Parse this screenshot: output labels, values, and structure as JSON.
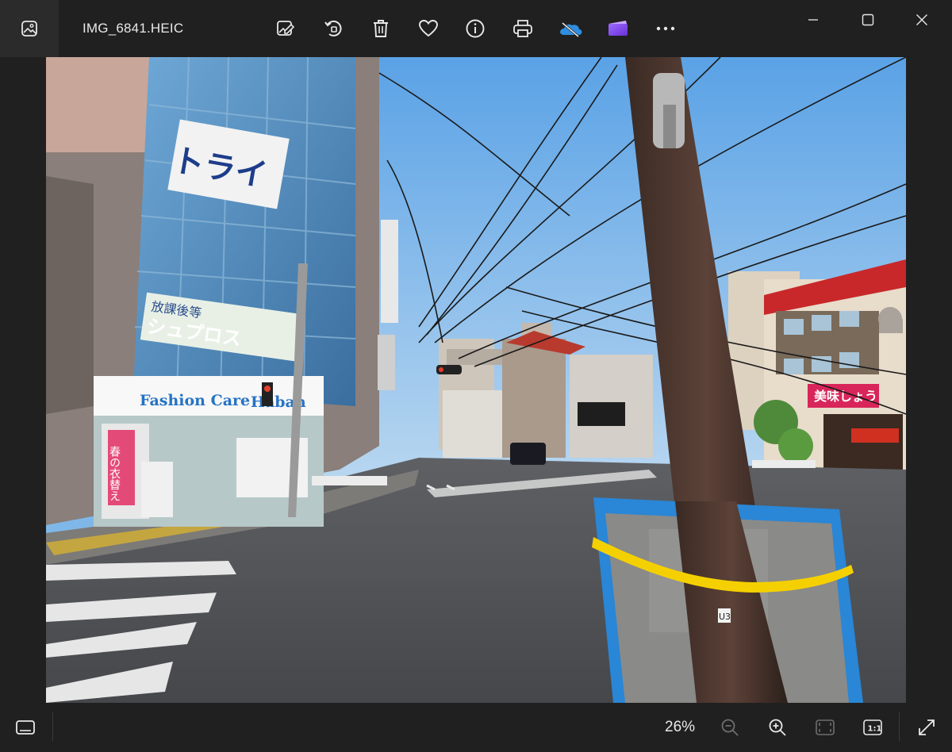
{
  "window": {
    "filename": "IMG_6841.HEIC"
  },
  "toolbar": {
    "icons": [
      "edit-image-icon",
      "rotate-icon",
      "delete-icon",
      "favorite-icon",
      "info-icon",
      "print-icon",
      "onedrive-icon",
      "clipchamp-icon",
      "more-icon"
    ]
  },
  "window_controls": [
    "minimize-icon",
    "maximize-icon",
    "close-icon"
  ],
  "photo": {
    "sign_fashion_care": "Fashion Care",
    "sign_fashion_care_2": "Haban",
    "sign_try": "トライ",
    "sign_school": "シュプロス",
    "sign_haru": "春の衣替え",
    "sign_bimi": "美味しょう",
    "sign_kanji": "放課後等",
    "pole_sticker": "U3",
    "accent_sky": "#7fb8e8",
    "accent_tape": "#f5d000",
    "accent_board": "#2a86d6"
  },
  "status": {
    "zoom": "26%"
  },
  "bottom_icons": [
    "filmstrip-icon",
    "zoom-out-icon",
    "zoom-in-icon",
    "fit-window-icon",
    "actual-size-icon",
    "fullscreen-icon"
  ]
}
